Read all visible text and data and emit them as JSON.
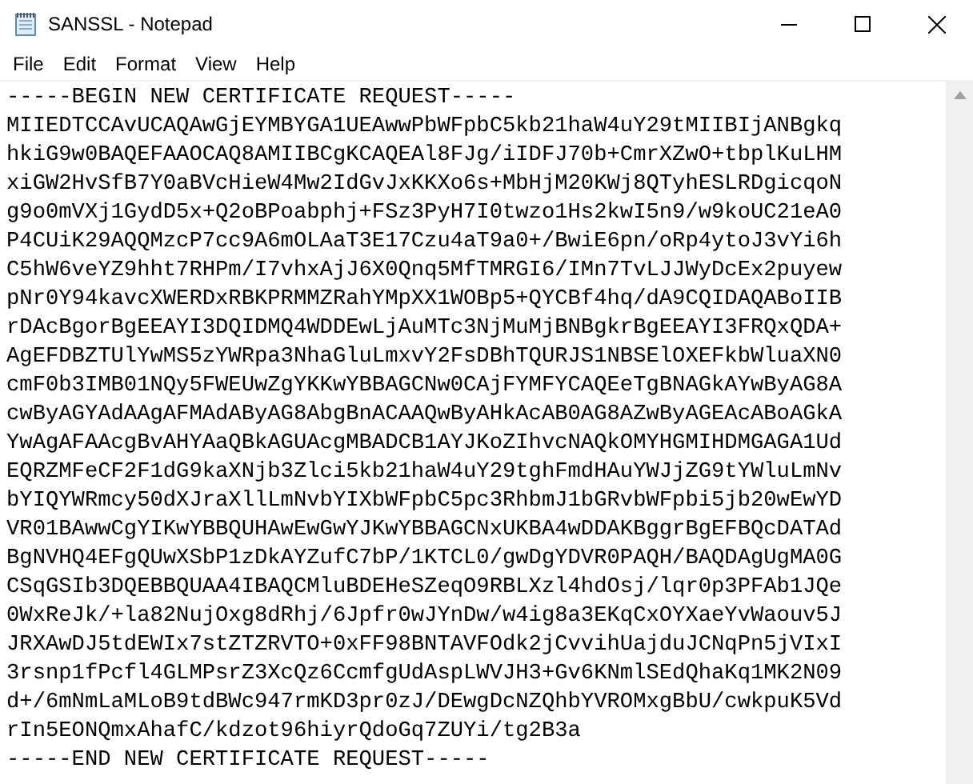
{
  "window": {
    "title": "SANSSL - Notepad"
  },
  "menu": [
    "File",
    "Edit",
    "Format",
    "View",
    "Help"
  ],
  "editor": {
    "lines": [
      "-----BEGIN NEW CERTIFICATE REQUEST-----",
      "MIIEDTCCAvUCAQAwGjEYMBYGA1UEAwwPbWFpbC5kb21haW4uY29tMIIBIjANBgkq",
      "hkiG9w0BAQEFAAOCAQ8AMIIBCgKCAQEAl8FJg/iIDFJ70b+CmrXZwO+tbplKuLHM",
      "xiGW2HvSfB7Y0aBVcHieW4Mw2IdGvJxKKXo6s+MbHjM20KWj8QTyhESLRDgicqoN",
      "g9o0mVXj1GydD5x+Q2oBPoabphj+FSz3PyH7I0twzo1Hs2kwI5n9/w9koUC21eA0",
      "P4CUiK29AQQMzcP7cc9A6mOLAaT3E17Czu4aT9a0+/BwiE6pn/oRp4ytoJ3vYi6h",
      "C5hW6veYZ9hht7RHPm/I7vhxAjJ6X0Qnq5MfTMRGI6/IMn7TvLJJWyDcEx2puyew",
      "pNr0Y94kavcXWERDxRBKPRMMZRahYMpXX1WOBp5+QYCBf4hq/dA9CQIDAQABoIIB",
      "rDAcBgorBgEEAYI3DQIDMQ4WDDEwLjAuMTc3NjMuMjBNBgkrBgEEAYI3FRQxQDA+",
      "AgEFDBZTUlYwMS5zYWRpa3NhaGluLmxvY2FsDBhTQURJS1NBSElOXEFkbWluaXN0",
      "cmF0b3IMB01NQy5FWEUwZgYKKwYBBAGCNw0CAjFYMFYCAQEeTgBNAGkAYwByAG8A",
      "cwByAGYAdAAgAFMAdAByAG8AbgBnACAAQwByAHkAcAB0AG8AZwByAGEAcABoAGkA",
      "YwAgAFAAcgBvAHYAaQBkAGUAcgMBADCB1AYJKoZIhvcNAQkOMYHGMIHDMGAGA1Ud",
      "EQRZMFeCF2F1dG9kaXNjb3Zlci5kb21haW4uY29tghFmdHAuYWJjZG9tYWluLmNv",
      "bYIQYWRmcy50dXJraXllLmNvbYIXbWFpbC5pc3RhbmJ1bGRvbWFpbi5jb20wEwYD",
      "VR01BAwwCgYIKwYBBQUHAwEwGwYJKwYBBAGCNxUKBA4wDDAKBggrBgEFBQcDATAd",
      "BgNVHQ4EFgQUwXSbP1zDkAYZufC7bP/1KTCL0/gwDgYDVR0PAQH/BAQDAgUgMA0G",
      "CSqGSIb3DQEBBQUAA4IBAQCMluBDEHeSZeqO9RBLXzl4hdOsj/lqr0p3PFAb1JQe",
      "0WxReJk/+la82NujOxg8dRhj/6Jpfr0wJYnDw/w4ig8a3EKqCxOYXaeYvWaouv5J",
      "JRXAwDJ5tdEWIx7stZTZRVTO+0xFF98BNTAVFOdk2jCvvihUajduJCNqPn5jVIxI",
      "3rsnp1fPcfl4GLMPsrZ3XcQz6CcmfgUdAspLWVJH3+Gv6KNmlSEdQhaKq1MK2N09",
      "d+/6mNmLaMLoB9tdBWc947rmKD3pr0zJ/DEwgDcNZQhbYVROMxgBbU/cwkpuK5Vd",
      "rIn5EONQmxAhafC/kdzot96hiyrQdoGq7ZUYi/tg2B3a",
      "-----END NEW CERTIFICATE REQUEST-----"
    ]
  }
}
